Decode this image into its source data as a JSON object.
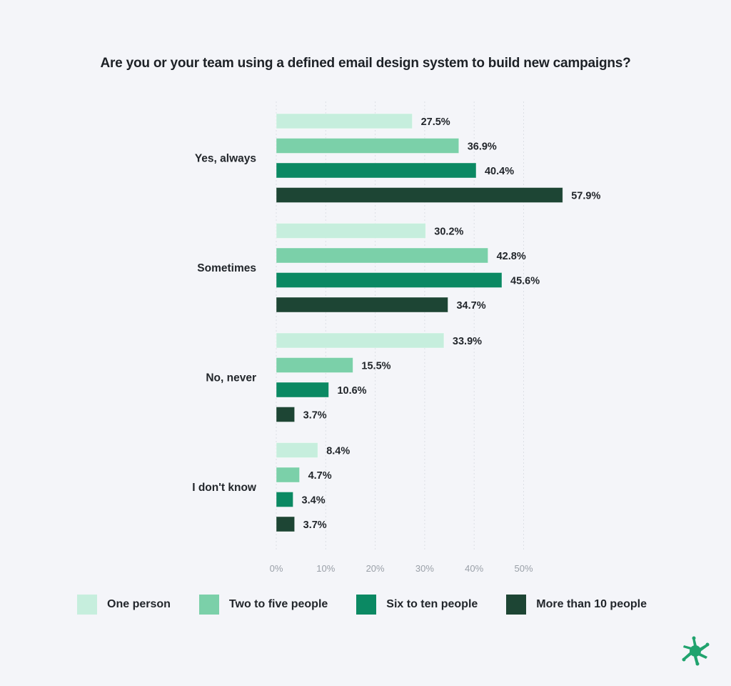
{
  "chart_data": {
    "type": "bar",
    "orientation": "horizontal",
    "title": "Are you or your team using a defined email design system to build new campaigns?",
    "xlabel": "",
    "ylabel": "",
    "xlim": [
      0,
      60
    ],
    "x_ticks": [
      "0%",
      "10%",
      "20%",
      "30%",
      "40%",
      "50%"
    ],
    "x_tick_values": [
      0,
      10,
      20,
      30,
      40,
      50
    ],
    "grid": "vertical dotted",
    "categories": [
      "Yes, always",
      "Sometimes",
      "No, never",
      "I don't know"
    ],
    "series": [
      {
        "name": "One person",
        "color": "#c6eedd",
        "values": [
          27.5,
          30.2,
          33.9,
          8.4
        ],
        "labels": [
          "27.5%",
          "30.2%",
          "33.9%",
          "8.4%"
        ]
      },
      {
        "name": "Two to five people",
        "color": "#7bd0a9",
        "values": [
          36.9,
          42.8,
          15.5,
          4.7
        ],
        "labels": [
          "36.9%",
          "42.8%",
          "15.5%",
          "4.7%"
        ]
      },
      {
        "name": "Six to ten people",
        "color": "#0b8963",
        "values": [
          40.4,
          45.6,
          10.6,
          3.4
        ],
        "labels": [
          "40.4%",
          "45.6%",
          "10.6%",
          "3.4%"
        ]
      },
      {
        "name": "More than 10 people",
        "color": "#1d4534",
        "values": [
          57.9,
          34.7,
          3.7,
          3.7
        ],
        "labels": [
          "57.9%",
          "34.7%",
          "3.7%",
          "3.7%"
        ]
      }
    ],
    "legend_position": "bottom"
  },
  "logo": {
    "icon": "green-splash-logo-icon",
    "color": "#20a36e"
  }
}
